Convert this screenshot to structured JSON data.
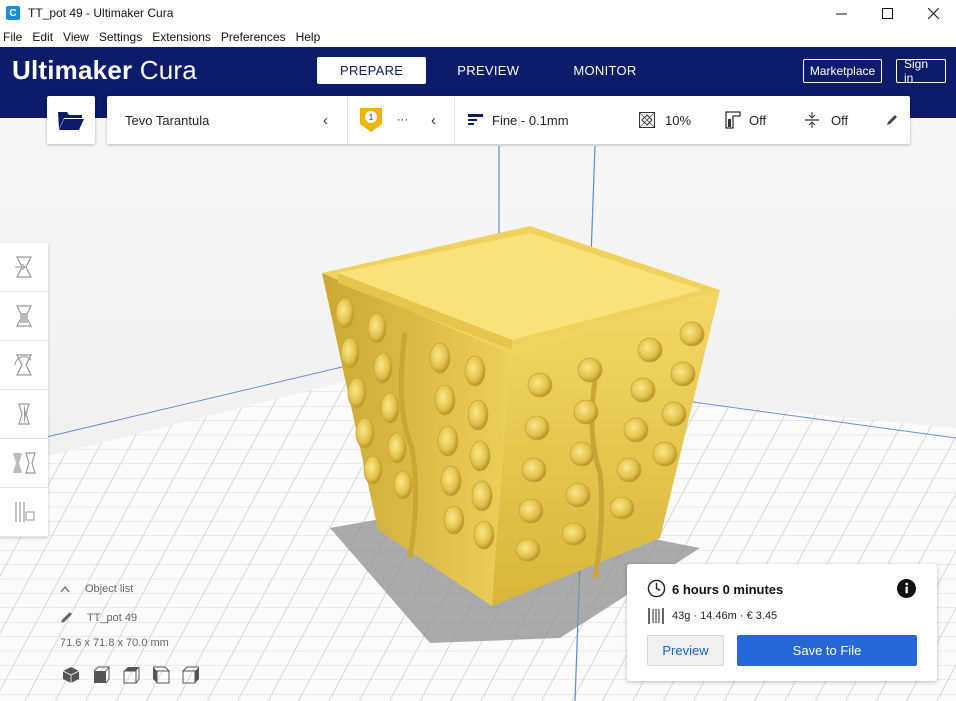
{
  "window": {
    "title": "TT_pot 49 - Ultimaker Cura",
    "app_icon": "C"
  },
  "menu": [
    "File",
    "Edit",
    "View",
    "Settings",
    "Extensions",
    "Preferences",
    "Help"
  ],
  "header": {
    "brand_bold": "Ultimaker",
    "brand_light": "Cura",
    "tabs": [
      {
        "label": "PREPARE",
        "active": true
      },
      {
        "label": "PREVIEW",
        "active": false
      },
      {
        "label": "MONITOR",
        "active": false
      }
    ],
    "marketplace_label": "Marketplace",
    "signin_label": "Sign in",
    "bg_color": "#0c1c6b"
  },
  "config": {
    "printer": "Tevo Tarantula",
    "extruder_number": "1",
    "extruder_more": "···",
    "profile": "Fine - 0.1mm",
    "infill": "10%",
    "support": "Off",
    "adhesion": "Off"
  },
  "object": {
    "list_label": "Object list",
    "name": "TT_pot 49",
    "dimensions": "71.6 x 71.8 x 70.0 mm"
  },
  "print": {
    "time": "6 hours 0 minutes",
    "material": "43g · 14.46m · € 3.45",
    "preview_label": "Preview",
    "save_label": "Save to File",
    "accent": "#2766d6"
  },
  "model_color": "#e8c84a"
}
